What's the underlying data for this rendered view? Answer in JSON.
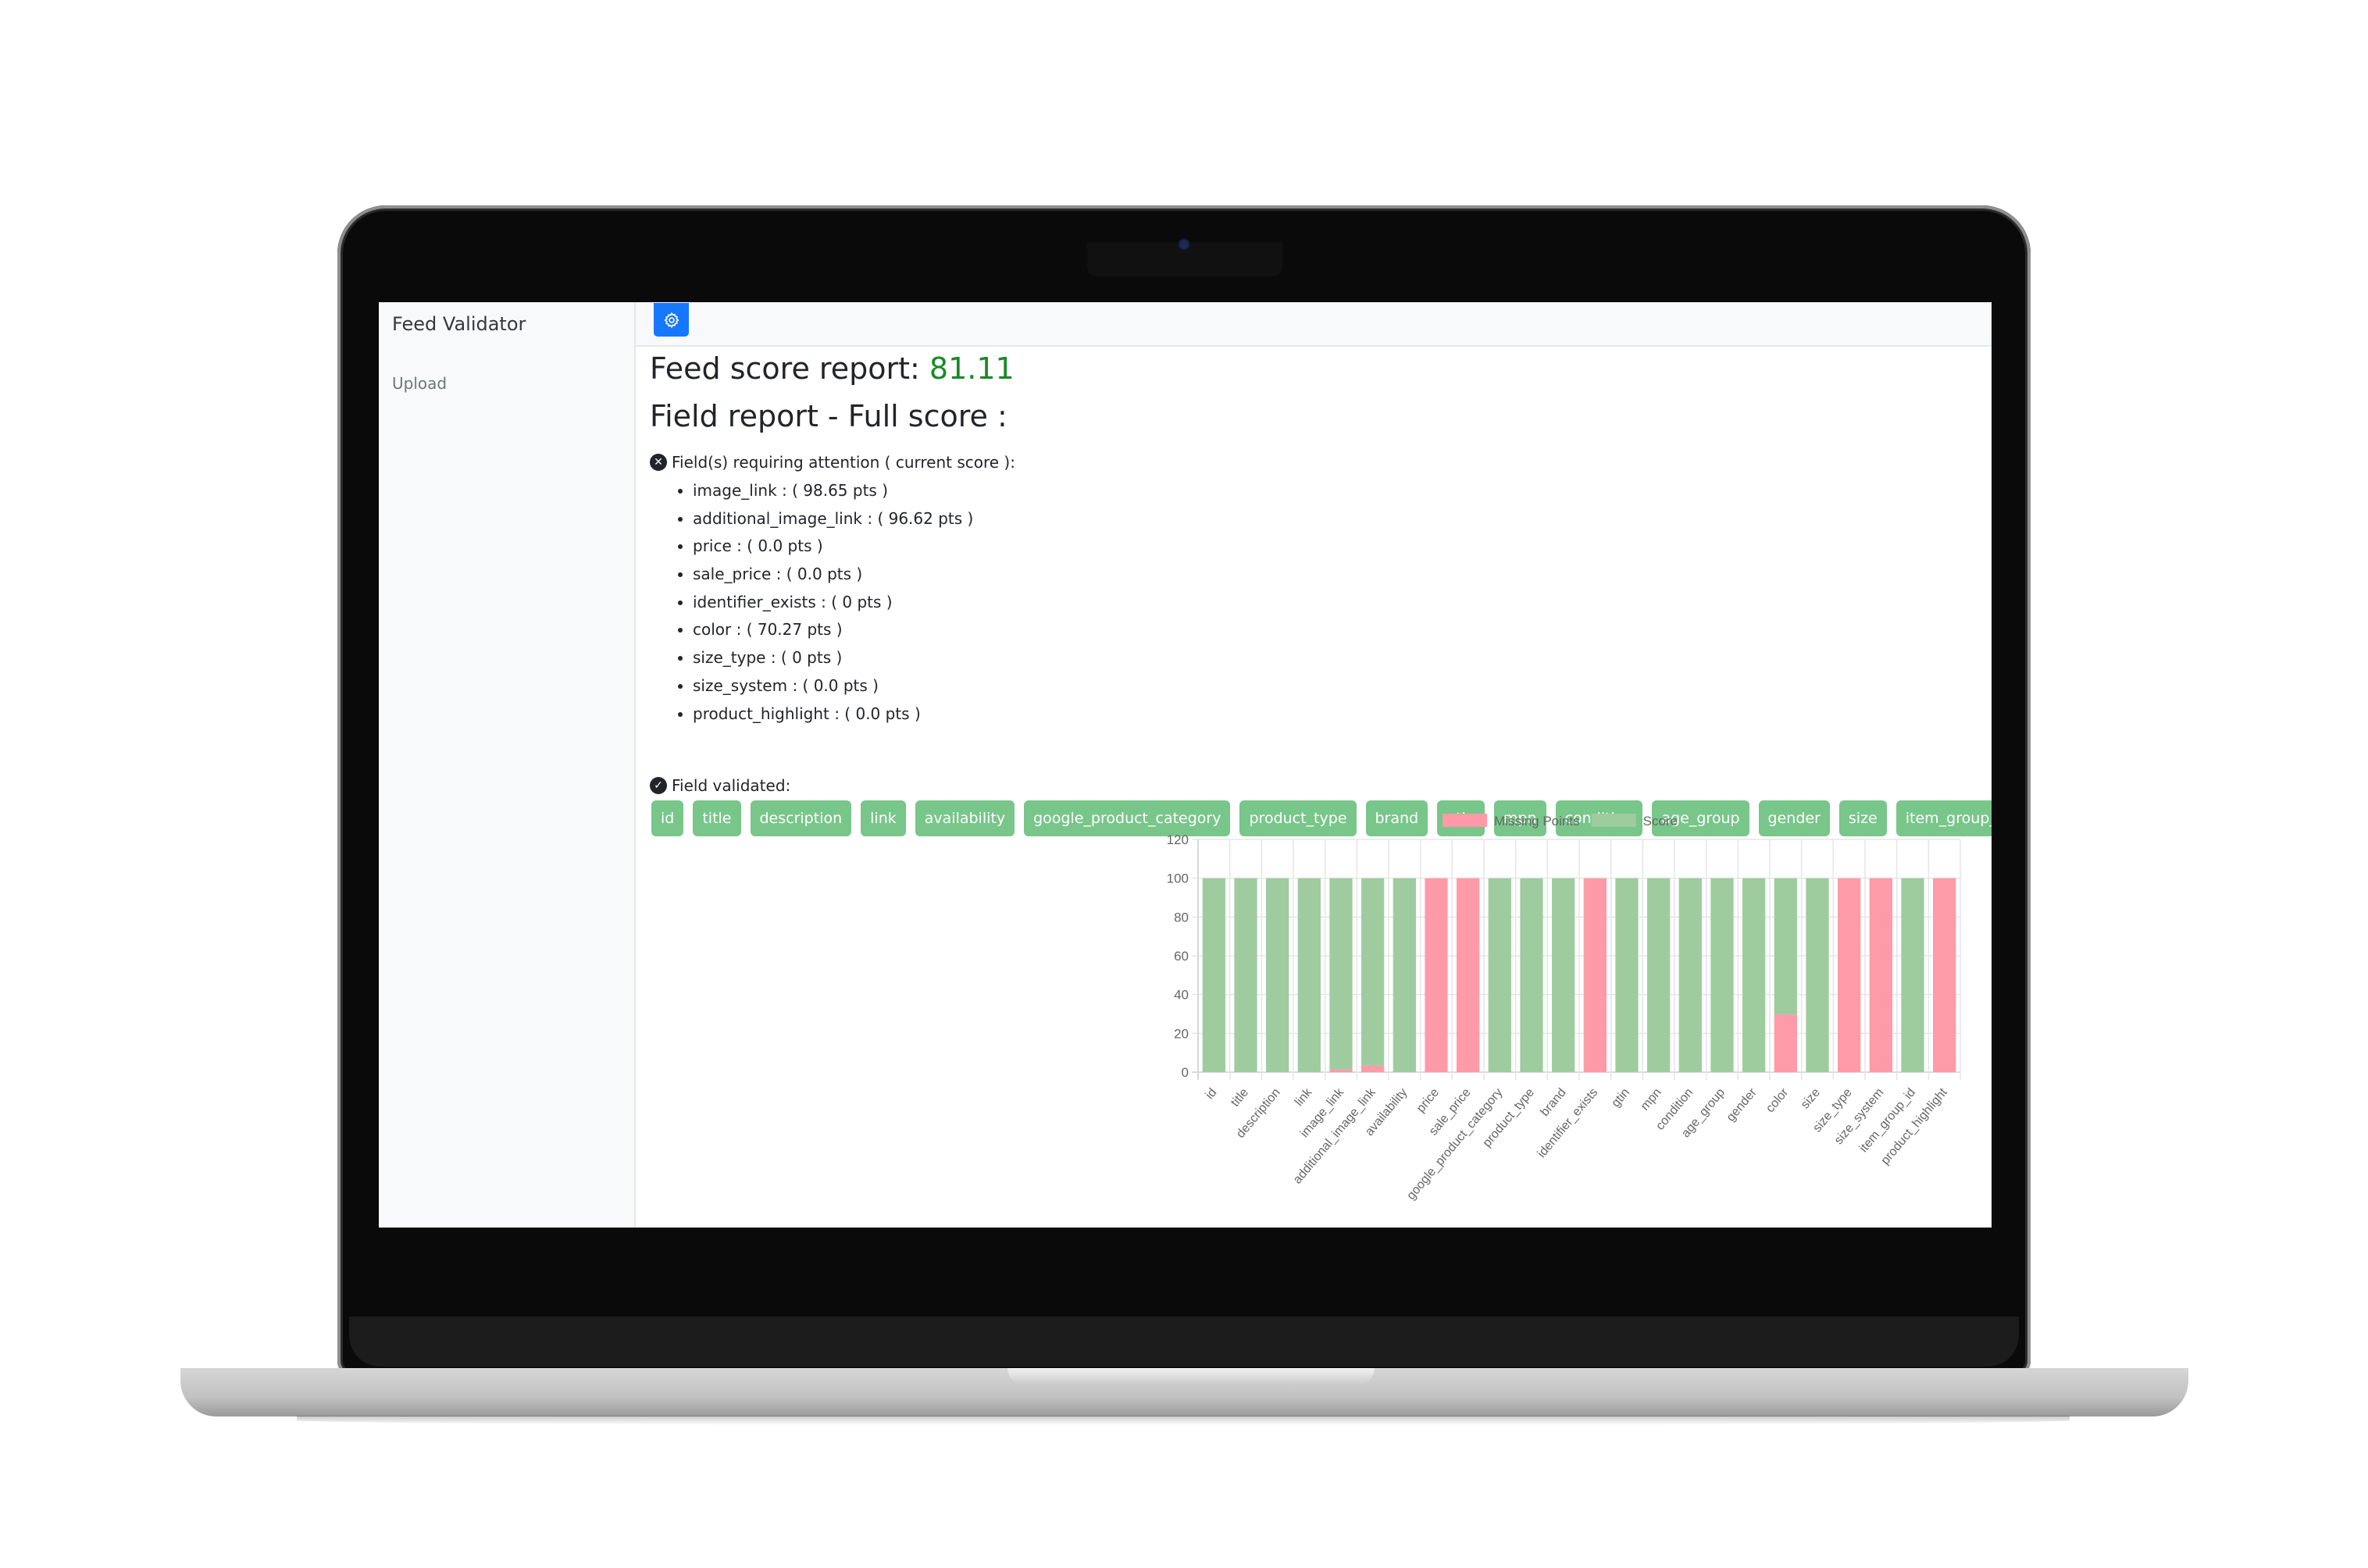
{
  "app": {
    "brand": "Feed Validator",
    "nav": [
      {
        "label": "Upload"
      }
    ],
    "settings_icon": "gear-icon"
  },
  "report": {
    "score_label": "Feed score report:",
    "score_value": "81.11",
    "score_color": "#198a26",
    "field_report_title": "Field report - Full score :",
    "attention_header": "Field(s) requiring attention ( current score ):",
    "attention_icon": "x-circle-icon",
    "attention_items": [
      "image_link : ( 98.65 pts )",
      "additional_image_link : ( 96.62 pts )",
      "price : ( 0.0 pts )",
      "sale_price : ( 0.0 pts )",
      "identifier_exists : ( 0 pts )",
      "color : ( 70.27 pts )",
      "size_type : ( 0 pts )",
      "size_system : ( 0.0 pts )",
      "product_highlight : ( 0.0 pts )"
    ],
    "validated_header": "Field validated:",
    "validated_icon": "check-circle-icon",
    "validated_fields": [
      "id",
      "title",
      "description",
      "link",
      "availability",
      "google_product_category",
      "product_type",
      "brand",
      "gtin",
      "mpn",
      "condition",
      "age_group",
      "gender",
      "size",
      "item_group_id"
    ],
    "badge_color": "#78c68a"
  },
  "chart_data": {
    "type": "bar",
    "stacked": true,
    "categories": [
      "id",
      "title",
      "description",
      "link",
      "image_link",
      "additional_image_link",
      "availability",
      "price",
      "sale_price",
      "google_product_category",
      "product_type",
      "brand",
      "identifier_exists",
      "gtin",
      "mpn",
      "condition",
      "age_group",
      "gender",
      "color",
      "size",
      "size_type",
      "size_system",
      "item_group_id",
      "product_highlight"
    ],
    "series": [
      {
        "name": "Missing Points",
        "color": "#ff9aa8",
        "values": [
          0,
          0,
          0,
          0,
          1.35,
          3.38,
          0,
          100,
          100,
          0,
          0,
          0,
          100,
          0,
          0,
          0,
          0,
          0,
          29.73,
          0,
          100,
          100,
          0,
          100
        ]
      },
      {
        "name": "Score",
        "color": "#9ecc9f",
        "values": [
          100,
          100,
          100,
          100,
          98.65,
          96.62,
          100,
          0,
          0,
          100,
          100,
          100,
          0,
          100,
          100,
          100,
          100,
          100,
          70.27,
          100,
          0,
          0,
          100,
          0
        ]
      }
    ],
    "title": "",
    "xlabel": "",
    "ylabel": "",
    "ylim": [
      0,
      120
    ],
    "yticks": [
      0,
      20,
      40,
      60,
      80,
      100,
      120
    ],
    "grid": true,
    "legend": "top-center"
  }
}
